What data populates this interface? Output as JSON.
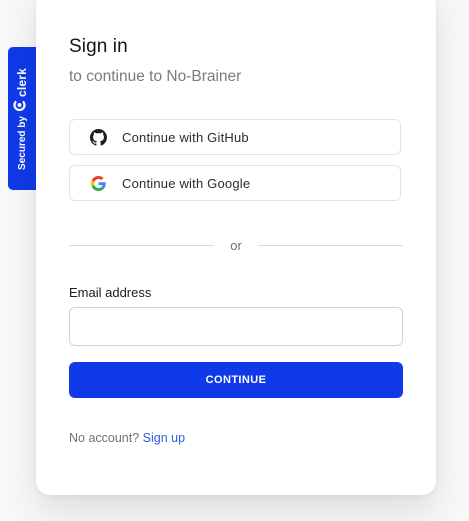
{
  "badge": {
    "secured_label": "Secured by",
    "brand": "clerk"
  },
  "signin": {
    "title": "Sign in",
    "subtitle": "to continue to No-Brainer",
    "github_label": "Continue with GitHub",
    "google_label": "Continue with Google",
    "divider_label": "or",
    "email_label": "Email address",
    "email_value": "",
    "continue_label": "CONTINUE",
    "no_account_text": "No account?",
    "sign_up_link": "Sign up"
  },
  "colors": {
    "accent": "#103ae9",
    "link": "#2e5fe0"
  },
  "icons": {
    "badge": "clerk-logo-icon",
    "github": "github-icon",
    "google": "google-icon"
  }
}
